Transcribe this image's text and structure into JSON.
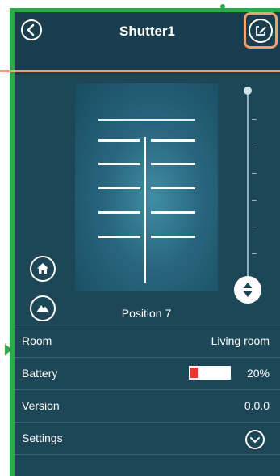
{
  "header": {
    "title": "Shutter1",
    "back_icon": "chevron-left-icon",
    "edit_icon": "edit-icon"
  },
  "shutter": {
    "position_label": "Position 7",
    "position_value": 7,
    "slats_count": 6
  },
  "controls": {
    "home_icon": "home-icon",
    "mountain_icon": "mountain-icon",
    "slider_handle_icon": "up-down-arrows-icon"
  },
  "details": {
    "room_label": "Room",
    "room_value": "Living room",
    "battery_label": "Battery",
    "battery_value": "20%",
    "battery_level": 0.2,
    "version_label": "Version",
    "version_value": "0.0.0",
    "settings_label": "Settings",
    "settings_icon": "chevron-down-icon"
  },
  "colors": {
    "background": "#1d4657",
    "accent_green": "#2aa84a",
    "highlight_orange": "#f0a070",
    "battery_low": "#e63a2a"
  }
}
